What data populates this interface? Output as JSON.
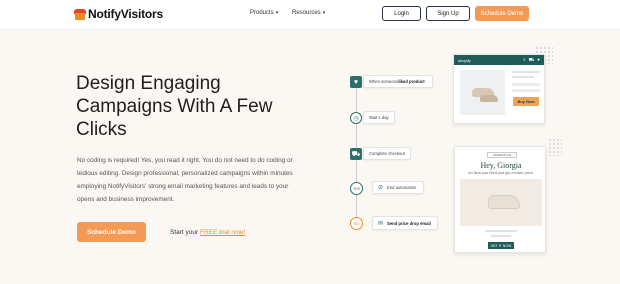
{
  "header": {
    "logo_text": "NotifyVisitors",
    "nav": [
      {
        "label": "Products",
        "caret": "▾"
      },
      {
        "label": "Resources",
        "caret": "▾"
      }
    ],
    "login_label": "Login",
    "signup_label": "Sign Up",
    "demo_label": "Schedule Demo"
  },
  "hero": {
    "title": "Design Engaging Campaigns With A Few Clicks",
    "description": "No coding is required! Yes, you read it right. You do not need to do coding or tedious editing. Design professional, personalized campaigns within minutes employing NotifyVisitors' strong email marketing features and leads to your opens and business improvement.",
    "cta_label": "Schedule Demo",
    "trial_prefix": "Start your ",
    "trial_link": "FREE trial now!"
  },
  "workflow": {
    "step1_prefix": "When someone ",
    "step1_highlight": "liked product",
    "step2": "Wait 1 day",
    "step3": "Complete checkout",
    "yes_label": "YES",
    "step4": "End automation",
    "no_label": "NO",
    "step5": "Send price drop email"
  },
  "shop_preview": {
    "brand": "shopify",
    "buy_label": "Buy Now"
  },
  "email_preview": {
    "logo": "SHOESTYLE",
    "greeting": "Hey, Giorgia",
    "subtext": "An item you liked just got a lower price.",
    "button": "GET IT NOW"
  },
  "colors": {
    "accent_orange": "#f59a54",
    "teal": "#2f6f6a",
    "background": "#fbf8f3"
  }
}
